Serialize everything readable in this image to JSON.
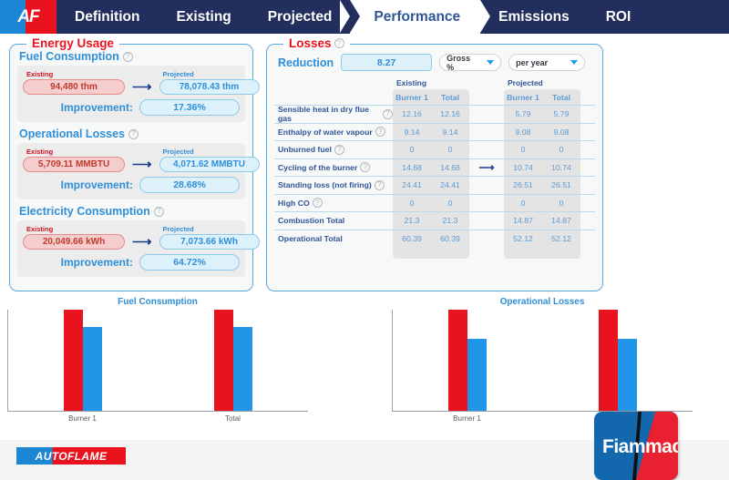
{
  "nav": {
    "logo_text": "AF",
    "tabs": [
      {
        "label": "Definition",
        "active": false
      },
      {
        "label": "Existing",
        "active": false
      },
      {
        "label": "Projected",
        "active": false
      },
      {
        "label": "Performance",
        "active": true
      },
      {
        "label": "Emissions",
        "active": false
      },
      {
        "label": "ROI",
        "active": false
      }
    ]
  },
  "energy_panel": {
    "title": "Energy Usage",
    "improvement_label": "Improvement:",
    "help_glyph": "?",
    "arrow_glyph": "⟶",
    "existing_label": "Existing",
    "projected_label": "Projected",
    "sections": [
      {
        "name": "Fuel Consumption",
        "existing_value": "94,480 thm",
        "projected_value": "78,078.43  thm",
        "improvement": "17.36%"
      },
      {
        "name": "Operational Losses",
        "existing_value": "5,709.11 MMBTU",
        "projected_value": "4,071.62  MMBTU",
        "improvement": "28.68%"
      },
      {
        "name": "Electricity Consumption",
        "existing_value": "20,049.66 kWh",
        "projected_value": "7,073.66  kWh",
        "improvement": "64.72%"
      }
    ]
  },
  "losses_panel": {
    "title": "Losses",
    "reduction_label": "Reduction",
    "reduction_value": "8.27",
    "unit_dropdown": "Gross %",
    "period_dropdown": "per year",
    "arrow_glyph": "⟶",
    "group_headers": [
      "Existing",
      "Projected"
    ],
    "sub_headers": [
      "Burner 1",
      "Total"
    ],
    "rows": [
      {
        "label": "Sensible heat in dry flue gas",
        "help": true,
        "existing_burner1": "12.16",
        "existing_total": "12.16",
        "projected_burner1": "5.79",
        "projected_total": "5.79",
        "arrow": false
      },
      {
        "label": "Enthalpy of water vapour",
        "help": true,
        "existing_burner1": "9.14",
        "existing_total": "9.14",
        "projected_burner1": "9.08",
        "projected_total": "9.08",
        "arrow": false
      },
      {
        "label": "Unburned fuel",
        "help": true,
        "existing_burner1": "0",
        "existing_total": "0",
        "projected_burner1": "0",
        "projected_total": "0",
        "arrow": false
      },
      {
        "label": "Cycling of the burner",
        "help": true,
        "existing_burner1": "14.68",
        "existing_total": "14.68",
        "projected_burner1": "10.74",
        "projected_total": "10.74",
        "arrow": true
      },
      {
        "label": "Standing loss (not firing)",
        "help": true,
        "existing_burner1": "24.41",
        "existing_total": "24.41",
        "projected_burner1": "26.51",
        "projected_total": "26.51",
        "arrow": false
      },
      {
        "label": "High CO",
        "help": true,
        "existing_burner1": "0",
        "existing_total": "0",
        "projected_burner1": "0",
        "projected_total": "0",
        "arrow": false
      },
      {
        "label": "Combustion Total",
        "help": false,
        "existing_burner1": "21.3",
        "existing_total": "21.3",
        "projected_burner1": "14.87",
        "projected_total": "14.87",
        "arrow": false
      },
      {
        "label": "Operational Total",
        "help": false,
        "existing_burner1": "60.39",
        "existing_total": "60.39",
        "projected_burner1": "52.12",
        "projected_total": "52.12",
        "arrow": false
      }
    ]
  },
  "chart_data": [
    {
      "type": "bar",
      "title": "Fuel Consumption",
      "categories": [
        "Burner 1",
        "Total"
      ],
      "series": [
        {
          "name": "Existing",
          "color": "#e8131e",
          "values": [
            100,
            100
          ]
        },
        {
          "name": "Projected",
          "color": "#2196e8",
          "values": [
            82.6,
            82.6
          ]
        }
      ],
      "xlabel": "",
      "ylabel": "",
      "ylim": [
        0,
        100
      ],
      "grid": false,
      "legend": "none"
    },
    {
      "type": "bar",
      "title": "Operational Losses",
      "categories": [
        "Burner 1",
        "Total"
      ],
      "series": [
        {
          "name": "Existing",
          "color": "#e8131e",
          "values": [
            100,
            100
          ]
        },
        {
          "name": "Projected",
          "color": "#2196e8",
          "values": [
            71.3,
            71.3
          ]
        }
      ],
      "xlabel": "",
      "ylabel": "",
      "ylim": [
        0,
        100
      ],
      "grid": false,
      "legend": "none"
    }
  ],
  "footer": {
    "autoflame_logo": "AUTOFLAME",
    "fiammac_logo": "Fiammac"
  }
}
